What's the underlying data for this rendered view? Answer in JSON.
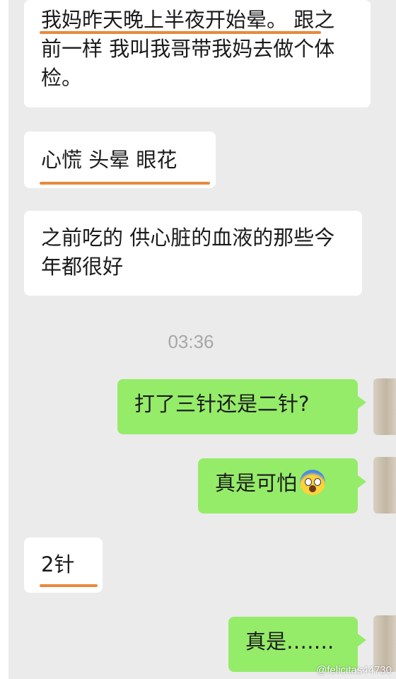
{
  "messages": [
    {
      "side": "in",
      "text": "我妈昨天晚上半夜开始晕。 跟之前一样 我叫我哥带我妈去做个体检。"
    },
    {
      "side": "in",
      "text": "心慌 头晕 眼花"
    },
    {
      "side": "in",
      "text": "之前吃的 供心脏的血液的那些今年都很好"
    },
    {
      "side": "out",
      "text": "打了三针还是二针?"
    },
    {
      "side": "out",
      "text": "真是可怕",
      "emoji": "screaming-face"
    },
    {
      "side": "in",
      "text": "2针"
    },
    {
      "side": "out",
      "text": "真是……."
    }
  ],
  "timestamp": "03:36",
  "watermark": "@felicitas44730",
  "colors": {
    "incoming": "#ffffff",
    "outgoing": "#95ec69",
    "underline": "#e8893a",
    "background": "#ebebeb"
  }
}
